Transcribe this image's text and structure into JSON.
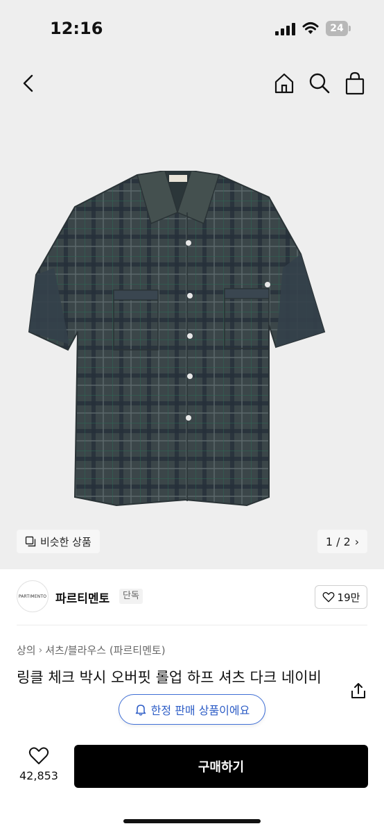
{
  "status_bar": {
    "time": "12:16",
    "battery": "24"
  },
  "nav": {
    "back_icon": "chevron-left-icon",
    "home_icon": "home-icon",
    "search_icon": "search-icon",
    "bag_icon": "shopping-bag-icon"
  },
  "gallery": {
    "similar_label": "비슷한 상품",
    "pager": "1 / 2",
    "shirt_label": "PARTIMENTO"
  },
  "brand": {
    "logo_text": "PARTIMENTO",
    "name": "파르티멘토",
    "tag": "단독",
    "likes": "19만"
  },
  "breadcrumb": {
    "level1": "상의",
    "level2": "셔츠/블라우스 (파르티멘토)"
  },
  "product": {
    "title": "링클 체크 박시 오버핏 롤업 하프 셔츠 다크 네이비",
    "limited_notice": "한정 판매 상품이에요"
  },
  "bottom": {
    "wish_count": "42,853",
    "buy_label": "구매하기"
  },
  "colors": {
    "accent_blue": "#3f6fd6",
    "buy_bg": "#000000",
    "shirt_base": "#3a4548"
  }
}
